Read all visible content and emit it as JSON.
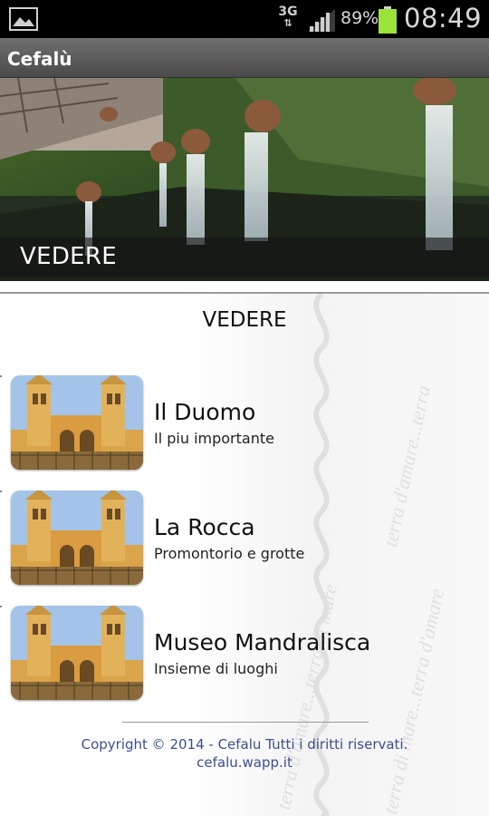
{
  "status_bar": {
    "network": "3G",
    "battery_percent": "89%",
    "time": "08:49",
    "left_icon": "gallery-icon",
    "battery_color": "#9be23a"
  },
  "action_bar": {
    "title": "Cefalù"
  },
  "hero": {
    "caption": "VEDERE"
  },
  "section": {
    "title": "VEDERE"
  },
  "items": [
    {
      "title": "Il Duomo",
      "subtitle": "Il piu importante"
    },
    {
      "title": "La Rocca",
      "subtitle": "Promontorio e grotte"
    },
    {
      "title": "Museo Mandralisca",
      "subtitle": "Insieme di luoghi"
    }
  ],
  "footer": {
    "copyright": "Copyright © 2014 - Cefalu Tutti i diritti riservati.",
    "url": "cefalu.wapp.it",
    "link_color": "#3a4f8f"
  },
  "watermark": {
    "text_a": "terra d'amare...terra di mare",
    "text_b": "terra di mare...terra d'amare",
    "text_c": "terra d'amare...terra"
  }
}
